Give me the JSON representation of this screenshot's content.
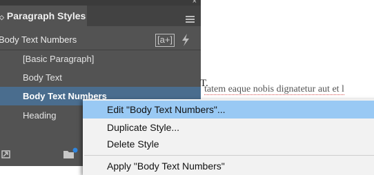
{
  "panel": {
    "tab_title": "Paragraph Styles",
    "tab_arrows": "◇",
    "current_style": "Body Text Numbers",
    "style_override_label": "[a+]",
    "styles": [
      {
        "label": "[Basic Paragraph]",
        "selected": false
      },
      {
        "label": "Body Text",
        "selected": false
      },
      {
        "label": "Body Text Numbers",
        "selected": true
      },
      {
        "label": "Heading",
        "selected": false
      }
    ]
  },
  "document": {
    "fragment_text": "T.",
    "line_text": "tatem eaque nobis dignatetur aut et l"
  },
  "context_menu": {
    "items": [
      {
        "label": "Edit \"Body Text Numbers\"...",
        "highlighted": true
      },
      {
        "label": "Duplicate Style...",
        "highlighted": false
      },
      {
        "label": "Delete Style",
        "highlighted": false
      },
      {
        "label": "Apply \"Body Text Numbers\"",
        "highlighted": false
      }
    ]
  },
  "colors": {
    "panel_bg": "#535353",
    "selected_row": "#4a6d8e",
    "menu_highlight": "#99c9f4"
  }
}
